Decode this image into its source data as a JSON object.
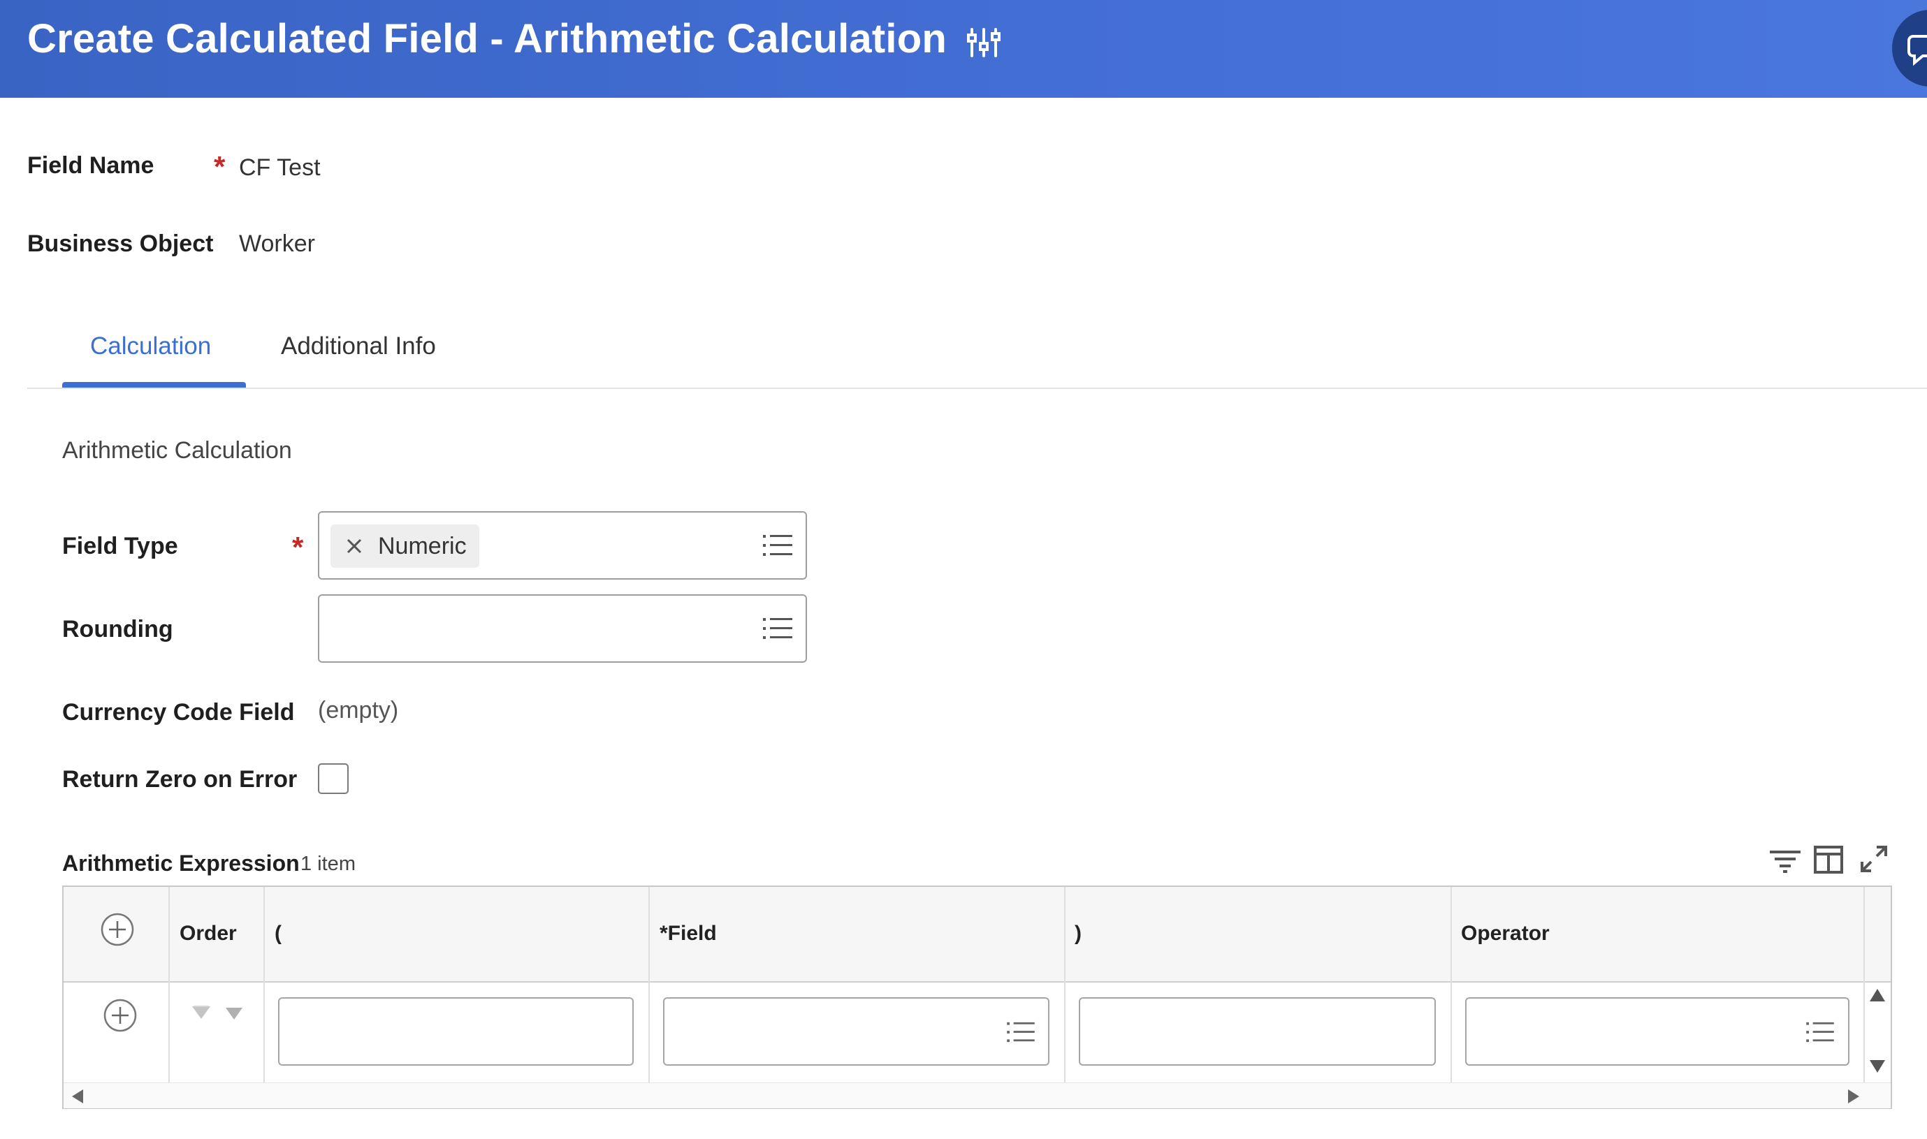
{
  "header": {
    "title": "Create Calculated Field - Arithmetic Calculation",
    "settings_icon": "sliders-icon",
    "avatar_icon": "chat-bubble-icon",
    "background": "#446fd6"
  },
  "form": {
    "field_name_label": "Field Name",
    "field_name_value": "CF Test",
    "business_object_label": "Business Object",
    "business_object_value": "Worker",
    "required_marker": "*"
  },
  "tabs": [
    {
      "label": "Calculation",
      "active": true
    },
    {
      "label": "Additional Info",
      "active": false
    }
  ],
  "calculation": {
    "section_title": "Arithmetic Calculation",
    "field_type_label": "Field Type",
    "field_type_value": "Numeric",
    "rounding_label": "Rounding",
    "rounding_value": "",
    "currency_label": "Currency Code Field",
    "currency_value": "(empty)",
    "return_zero_label": "Return Zero on Error",
    "return_zero_checked": false
  },
  "expression_grid": {
    "title": "Arithmetic Expression",
    "count": "1 item",
    "tools": [
      "filter-icon",
      "columns-icon",
      "expand-icon"
    ],
    "columns": [
      "Order",
      "(",
      "*Field",
      ")",
      "Operator"
    ],
    "rows": [
      {
        "order": "",
        "open_paren": "",
        "field": "",
        "close_paren": "",
        "operator": ""
      }
    ]
  },
  "colors": {
    "accent": "#3b6fd4",
    "required": "#c62828",
    "border": "#9e9e9e"
  }
}
